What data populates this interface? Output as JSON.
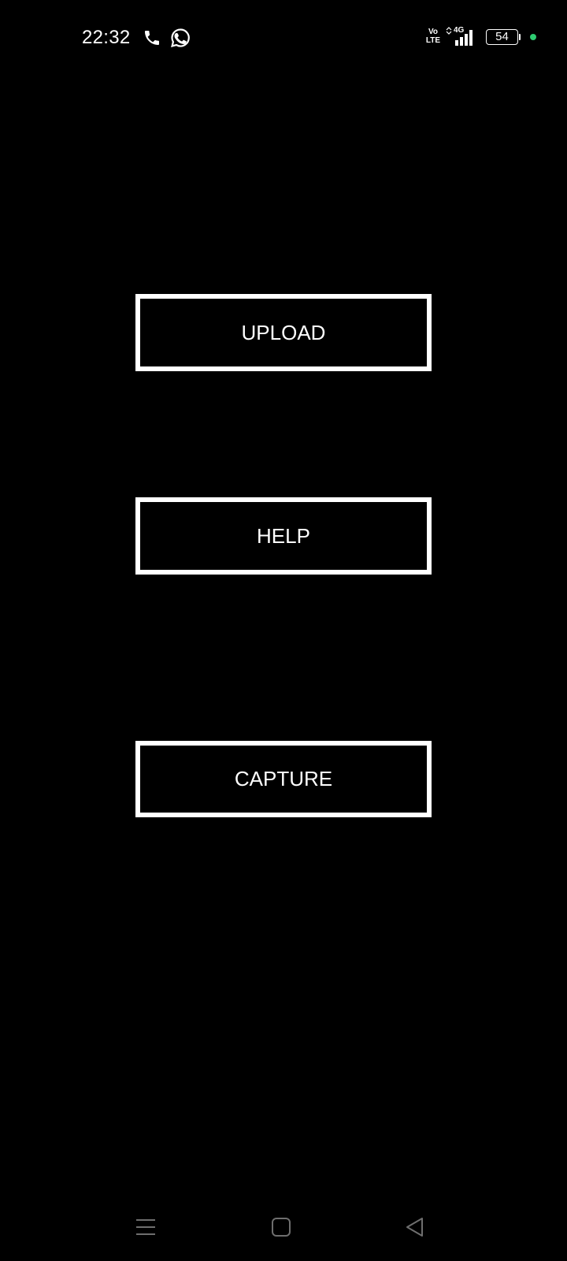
{
  "status_bar": {
    "time": "22:32",
    "volte_top": "Vo",
    "volte_bottom": "LTE",
    "network_type": "4G",
    "battery_level": "54",
    "dot_color": "#2ecc71",
    "icons": [
      "call-icon",
      "whatsapp-icon",
      "volte-icon",
      "signal-icon",
      "battery-icon",
      "dot-indicator"
    ]
  },
  "buttons": {
    "upload": "UPLOAD",
    "help": "HELP",
    "capture": "CAPTURE"
  },
  "nav_bar": {
    "icons": [
      "menu-icon",
      "home-icon",
      "back-icon"
    ]
  },
  "colors": {
    "background": "#000000",
    "foreground": "#ffffff"
  }
}
